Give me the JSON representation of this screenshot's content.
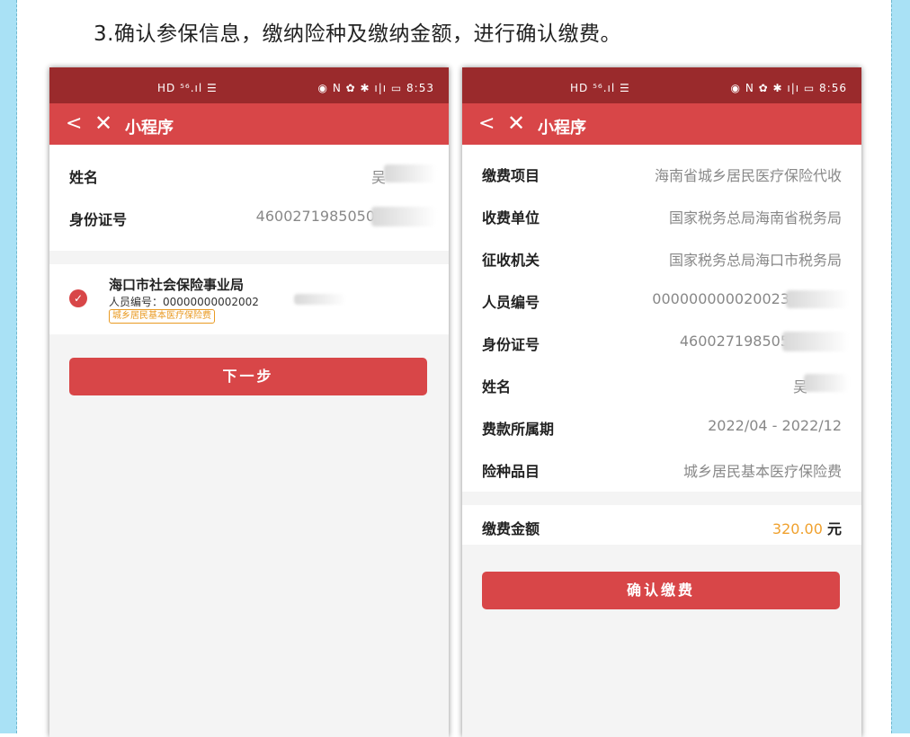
{
  "heading": "3.确认参保信息，缴纳险种及缴纳金额，进行确认缴费。",
  "left_phone": {
    "status": {
      "left": "HD ⁵⁶.ıl ☰",
      "right": "◉ N ✿ ✱ ı|ı ▭ 8:53"
    },
    "nav": {
      "back": "<",
      "close": "✕",
      "title": "小程序"
    },
    "rows": [
      {
        "label": "姓名",
        "value": "吴"
      },
      {
        "label": "身份证号",
        "value": "4600271985050"
      }
    ],
    "entry": {
      "org": "海口市社会保险事业局",
      "person_id": "人员编号：00000000002002",
      "tag": "城乡居民基本医疗保险费"
    },
    "next_button": "下一步"
  },
  "right_phone": {
    "status": {
      "left": "HD ⁵⁶.ıl ☰",
      "right": "◉ N ✿ ✱ ı|ı ▭ 8:56"
    },
    "nav": {
      "back": "<",
      "close": "✕",
      "title": "小程序"
    },
    "rows": [
      {
        "label": "缴费项目",
        "value": "海南省城乡居民医疗保险代收"
      },
      {
        "label": "收费单位",
        "value": "国家税务总局海南省税务局"
      },
      {
        "label": "征收机关",
        "value": "国家税务总局海口市税务局"
      },
      {
        "label": "人员编号",
        "value": "000000000020023"
      },
      {
        "label": "身份证号",
        "value": "460027198505"
      },
      {
        "label": "姓名",
        "value": "吴"
      },
      {
        "label": "费款所属期",
        "value": "2022/04 - 2022/12"
      },
      {
        "label": "险种品目",
        "value": "城乡居民基本医疗保险费"
      }
    ],
    "amount": {
      "label": "缴费金额",
      "value": "320.00",
      "unit": "元"
    },
    "confirm_button": "确认缴费"
  }
}
